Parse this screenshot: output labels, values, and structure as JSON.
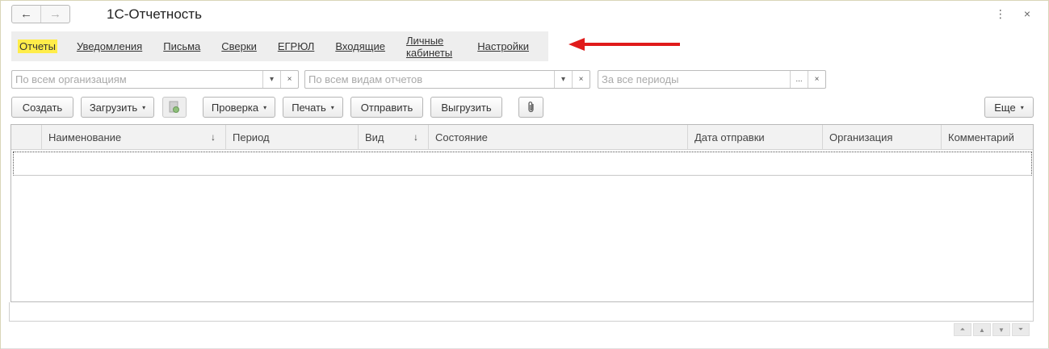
{
  "window": {
    "title": "1С-Отчетность",
    "nav": {
      "back_icon": "←",
      "forward_icon": "→"
    },
    "actions": {
      "more_icon": "⋮",
      "close_icon": "×"
    }
  },
  "sections": {
    "items": [
      {
        "label": "Отчеты",
        "active": true
      },
      {
        "label": "Уведомления"
      },
      {
        "label": "Письма"
      },
      {
        "label": "Сверки"
      },
      {
        "label": "ЕГРЮЛ"
      },
      {
        "label": "Входящие"
      },
      {
        "label": "Личные кабинеты"
      },
      {
        "label": "Настройки"
      }
    ],
    "arrow_color": "#e01b1b"
  },
  "filters": {
    "organization": {
      "placeholder": "По всем организациям",
      "dropdown_icon": "▾",
      "clear_icon": "×"
    },
    "report_type": {
      "placeholder": "По всем видам отчетов",
      "dropdown_icon": "▾",
      "clear_icon": "×"
    },
    "period": {
      "placeholder": "За все периоды",
      "select_icon": "...",
      "clear_icon": "×"
    }
  },
  "toolbar": {
    "create": "Создать",
    "load": "Загрузить",
    "check": "Проверка",
    "print": "Печать",
    "send": "Отправить",
    "export": "Выгрузить",
    "more": "Еще",
    "dropdown_icon": "▾",
    "attach_icon": "📎"
  },
  "table": {
    "columns": [
      {
        "label": "",
        "sort": ""
      },
      {
        "label": "Наименование",
        "sort": "↓"
      },
      {
        "label": "Период",
        "sort": ""
      },
      {
        "label": "Вид",
        "sort": "↓"
      },
      {
        "label": "Состояние",
        "sort": ""
      },
      {
        "label": "Дата отправки",
        "sort": ""
      },
      {
        "label": "Организация",
        "sort": ""
      },
      {
        "label": "Комментарий",
        "sort": ""
      }
    ],
    "rows": []
  },
  "scroll_nav": {
    "first": "⏶",
    "up": "▲",
    "down": "▼",
    "last": "⏷"
  },
  "colors": {
    "accent_yellow": "#ffed4a",
    "panel_gray": "#eeeeee"
  }
}
